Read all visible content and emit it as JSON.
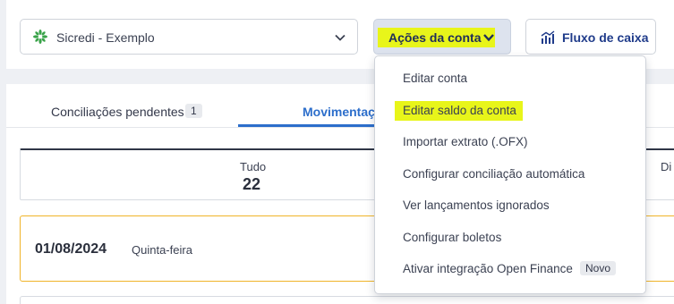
{
  "header": {
    "account_name": "Sicredi - Exemplo",
    "actions_label": "Ações da conta",
    "cashflow_label": "Fluxo de caixa"
  },
  "tabs": [
    {
      "label": "Conciliações pendentes",
      "badge": "1"
    },
    {
      "label": "Movimentaç"
    }
  ],
  "summary": {
    "label": "Tudo",
    "value": "22",
    "cut_label": "Di"
  },
  "entry": {
    "date": "01/08/2024",
    "weekday": "Quinta-feira"
  },
  "actions_menu": {
    "items": [
      {
        "label": "Editar conta"
      },
      {
        "label": "Editar saldo da conta"
      },
      {
        "label": "Importar extrato (.OFX)"
      },
      {
        "label": "Configurar conciliação automática"
      },
      {
        "label": "Ver lançamentos ignorados"
      },
      {
        "label": "Configurar boletos"
      },
      {
        "label": "Ativar integração Open Finance",
        "badge": "Novo"
      }
    ]
  },
  "colors": {
    "highlight": "#e8f51a",
    "accent": "#2c6ecb",
    "warning_border": "#f0b429"
  }
}
